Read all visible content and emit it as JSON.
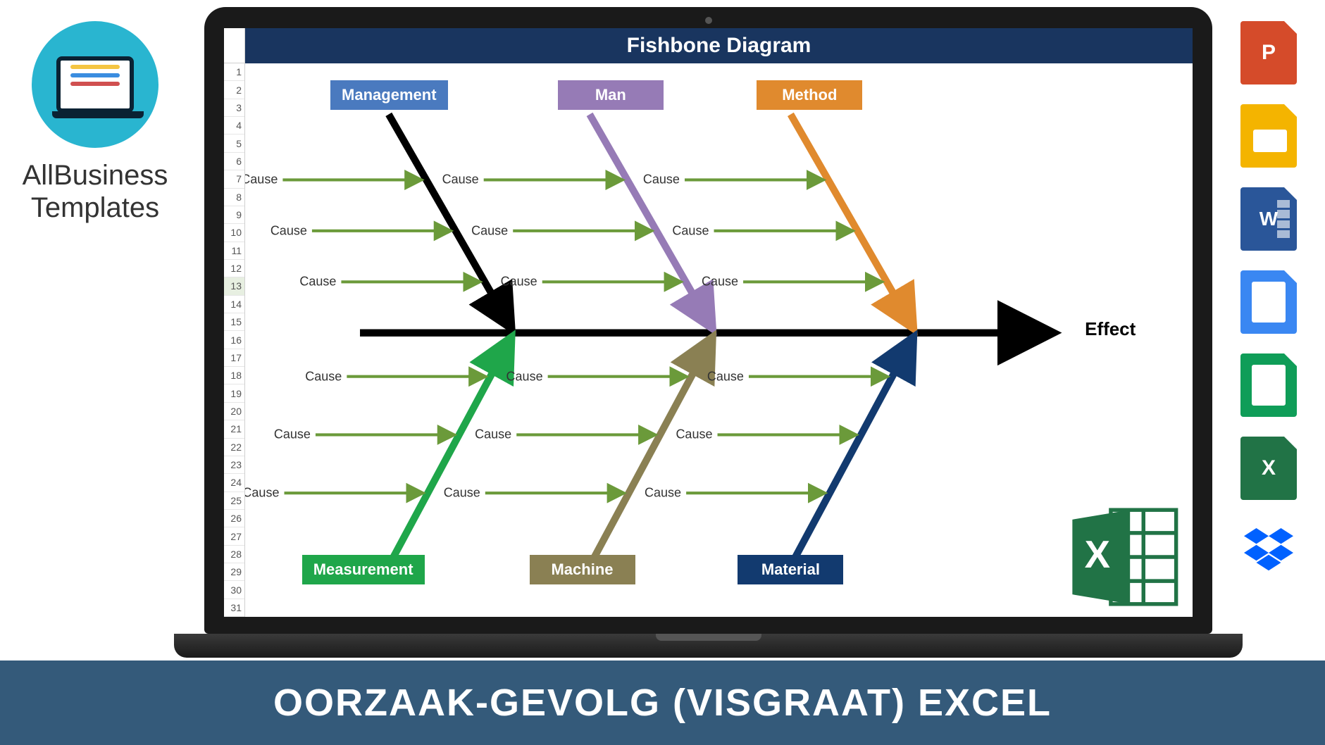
{
  "brand": {
    "line1": "AllBusiness",
    "line2": "Templates"
  },
  "bottom_banner": "OORZAAK-GEVOLG (VISGRAAT) EXCEL",
  "app_icons": [
    {
      "name": "powerpoint",
      "glyph": "P"
    },
    {
      "name": "google-slides",
      "glyph": ""
    },
    {
      "name": "word",
      "glyph": "W"
    },
    {
      "name": "google-docs",
      "glyph": ""
    },
    {
      "name": "google-sheets",
      "glyph": ""
    },
    {
      "name": "excel",
      "glyph": "X"
    },
    {
      "name": "dropbox",
      "glyph": ""
    }
  ],
  "sheet": {
    "title": "Fishbone Diagram",
    "row_numbers": [
      1,
      2,
      3,
      4,
      5,
      6,
      7,
      8,
      9,
      10,
      11,
      12,
      13,
      14,
      15,
      16,
      17,
      18,
      19,
      20,
      21,
      22,
      23,
      24,
      25,
      26,
      27,
      28,
      29,
      30,
      31
    ],
    "highlight_row": 13,
    "effect_label": "Effect",
    "categories_top": [
      {
        "name": "Management",
        "color": "#4a7abf"
      },
      {
        "name": "Man",
        "color": "#967bb6"
      },
      {
        "name": "Method",
        "color": "#e08a2e"
      }
    ],
    "categories_bottom": [
      {
        "name": "Measurement",
        "color": "#1fa64a"
      },
      {
        "name": "Machine",
        "color": "#8a8053"
      },
      {
        "name": "Material",
        "color": "#123a6f"
      }
    ],
    "cause_label": "Cause"
  },
  "corner_icon": "excel"
}
